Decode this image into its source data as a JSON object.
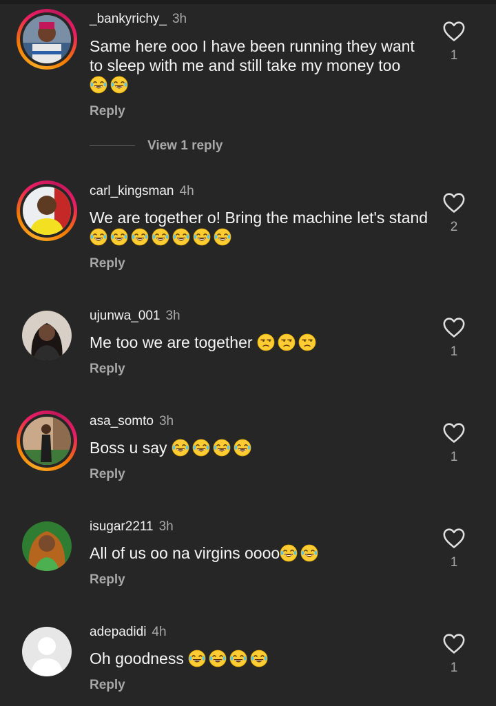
{
  "comments": [
    {
      "username": "_bankyrichy_",
      "time": "3h",
      "text": "Same here ooo I have been running they want to sleep with me and still take my money  too",
      "emojis": [
        "laugh",
        "laugh"
      ],
      "reply": "Reply",
      "likes": "1"
    },
    {
      "username": "carl_kingsman",
      "time": "4h",
      "text": "We are together o! Bring the machine let's stand",
      "emojis": [
        "laugh",
        "laugh",
        "laugh",
        "laugh",
        "laugh",
        "laugh",
        "laugh"
      ],
      "reply": "Reply",
      "likes": "2"
    },
    {
      "username": "ujunwa_001",
      "time": "3h",
      "text": "Me too we are together",
      "emojis": [
        "unamused",
        "unamused",
        "unamused"
      ],
      "reply": "Reply",
      "likes": "1"
    },
    {
      "username": "asa_somto",
      "time": "3h",
      "text": "Boss u say",
      "emojis": [
        "laugh",
        "laugh",
        "laugh",
        "laugh"
      ],
      "reply": "Reply",
      "likes": "1"
    },
    {
      "username": "isugar2211",
      "time": "3h",
      "text": "All of us oo na virgins oooo",
      "emojis": [
        "laugh",
        "laugh"
      ],
      "reply": "Reply",
      "likes": "1"
    },
    {
      "username": "adepadidi",
      "time": "4h",
      "text": "Oh goodness",
      "emojis": [
        "laugh",
        "laugh",
        "laugh",
        "laugh"
      ],
      "reply": "Reply",
      "likes": "1"
    }
  ],
  "view_replies": "View 1 reply",
  "icons": {
    "like": "heart-outline-icon",
    "laugh": "face-with-tears-of-joy",
    "unamused": "unamused-face"
  },
  "colors": {
    "background": "#262626",
    "muted": "#a8a8a8",
    "story_ring": "#e91e63"
  }
}
